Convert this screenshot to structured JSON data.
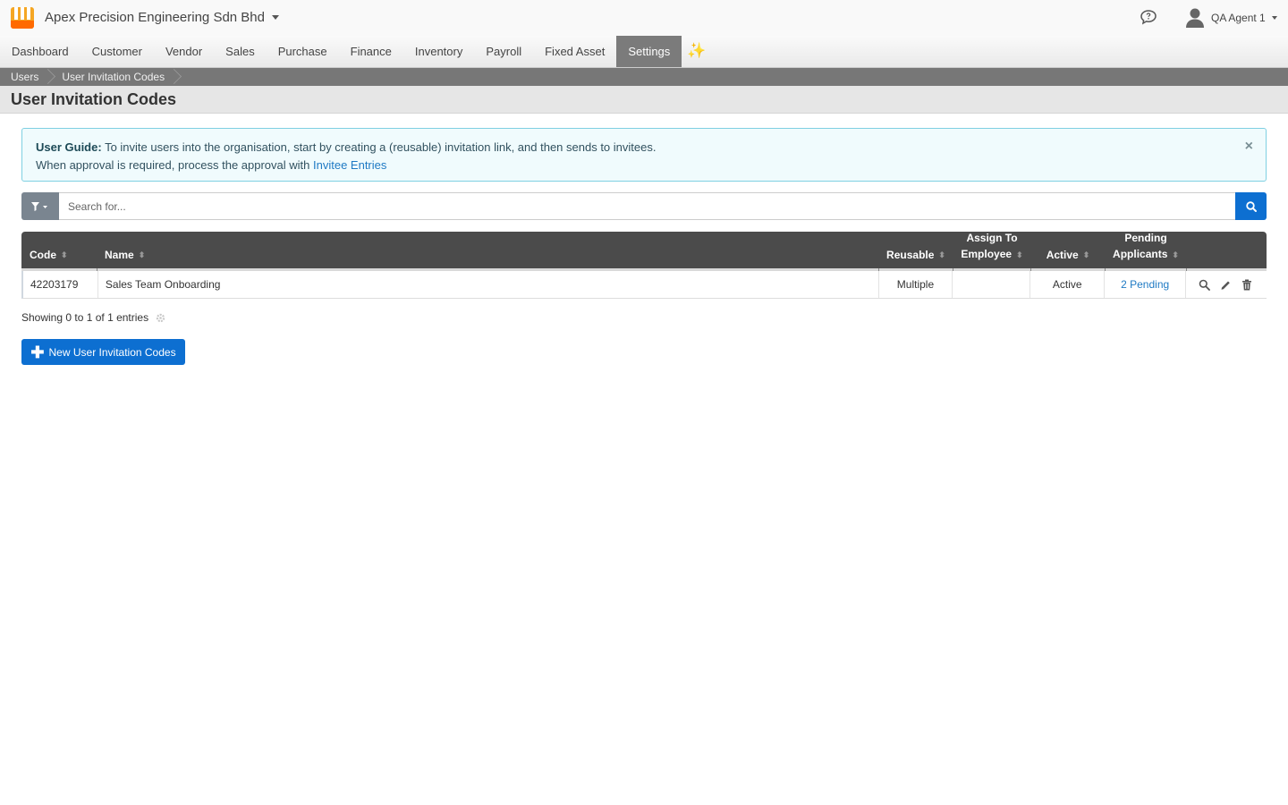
{
  "header": {
    "company": "Apex Precision Engineering Sdn Bhd",
    "user": "QA Agent 1"
  },
  "nav": {
    "items": [
      {
        "label": "Dashboard"
      },
      {
        "label": "Customer"
      },
      {
        "label": "Vendor"
      },
      {
        "label": "Sales"
      },
      {
        "label": "Purchase"
      },
      {
        "label": "Finance"
      },
      {
        "label": "Inventory"
      },
      {
        "label": "Payroll"
      },
      {
        "label": "Fixed Asset"
      },
      {
        "label": "Settings"
      }
    ],
    "active": "Settings",
    "extra_icon": "sparkles-icon"
  },
  "breadcrumb": [
    "Users",
    "User Invitation Codes"
  ],
  "page": {
    "title": "User Invitation Codes"
  },
  "alert": {
    "label": "User Guide:",
    "line1": " To invite users into the organisation, start by creating a (reusable) invitation link, and then sends to invitees.",
    "line2": "When approval is required, process the approval with ",
    "link": "Invitee Entries",
    "close": "×"
  },
  "search": {
    "placeholder": "Search for..."
  },
  "table": {
    "headers": {
      "code": "Code",
      "name": "Name",
      "reusable": "Reusable",
      "assign_line1": "Assign To",
      "assign_line2": "Employee",
      "active": "Active",
      "pending_line1": "Pending",
      "pending_line2": "Applicants"
    },
    "rows": [
      {
        "code": "42203179",
        "name": "Sales Team Onboarding",
        "reusable": "Multiple",
        "assign": "",
        "active": "Active",
        "pending": "2 Pending"
      }
    ]
  },
  "footer": {
    "showing": "Showing 0 to 1 of 1 entries",
    "new_button": "New User Invitation Codes"
  },
  "colors": {
    "primary": "#0d6fd1",
    "nav_active": "#7b7b7b",
    "table_header": "#4b4b4b",
    "alert_bg": "#f0fbfd",
    "link": "#1f7ac4"
  }
}
